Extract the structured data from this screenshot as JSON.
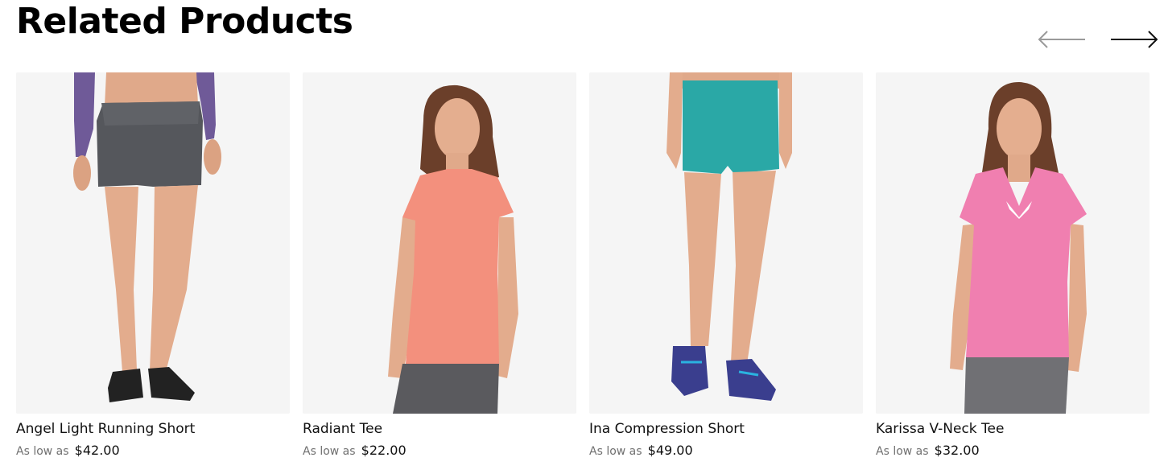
{
  "section": {
    "title": "Related Products",
    "prev_icon": "arrow-left-icon",
    "next_icon": "arrow-right-icon"
  },
  "products": [
    {
      "name": "Angel Light Running Short",
      "price_prefix": "As low as",
      "price": "$42.00",
      "image": "product-image-gray-running-shorts"
    },
    {
      "name": "Radiant Tee",
      "price_prefix": "As low as",
      "price": "$22.00",
      "image": "product-image-coral-tee"
    },
    {
      "name": "Ina Compression Short",
      "price_prefix": "As low as",
      "price": "$49.00",
      "image": "product-image-teal-compression-shorts"
    },
    {
      "name": "Karissa V-Neck Tee",
      "price_prefix": "As low as",
      "price": "$32.00",
      "image": "product-image-pink-vneck-tee"
    }
  ],
  "colors": {
    "image_background": "#f5f5f5",
    "arrow_disabled": "#9a9a9a",
    "arrow_active": "#111111",
    "text": "#111111",
    "muted_text": "#707070"
  }
}
